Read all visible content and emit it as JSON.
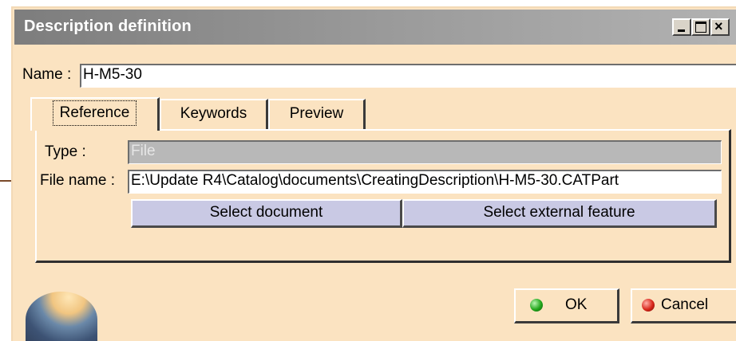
{
  "window": {
    "title": "Description definition",
    "close_glyph": "×"
  },
  "name_field": {
    "label": "Name :",
    "value": "H-M5-30"
  },
  "tabs": [
    {
      "label": "Reference",
      "active": true
    },
    {
      "label": "Keywords",
      "active": false
    },
    {
      "label": "Preview",
      "active": false
    }
  ],
  "reference": {
    "type_label": "Type :",
    "type_value": "File",
    "filename_label": "File name :",
    "filename_value": "E:\\Update R4\\Catalog\\documents\\CreatingDescription\\H-M5-30.CATPart",
    "select_document": "Select document",
    "select_external_feature": "Select external feature"
  },
  "footer": {
    "ok_label": "OK",
    "cancel_label": "Cancel"
  },
  "colors": {
    "dialog_bg": "#fbe3c1",
    "button_bg": "#c9c9e4"
  },
  "icons": {
    "ok": "green-dot-icon",
    "cancel": "red-dot-icon",
    "callout": "arrow-icon"
  }
}
